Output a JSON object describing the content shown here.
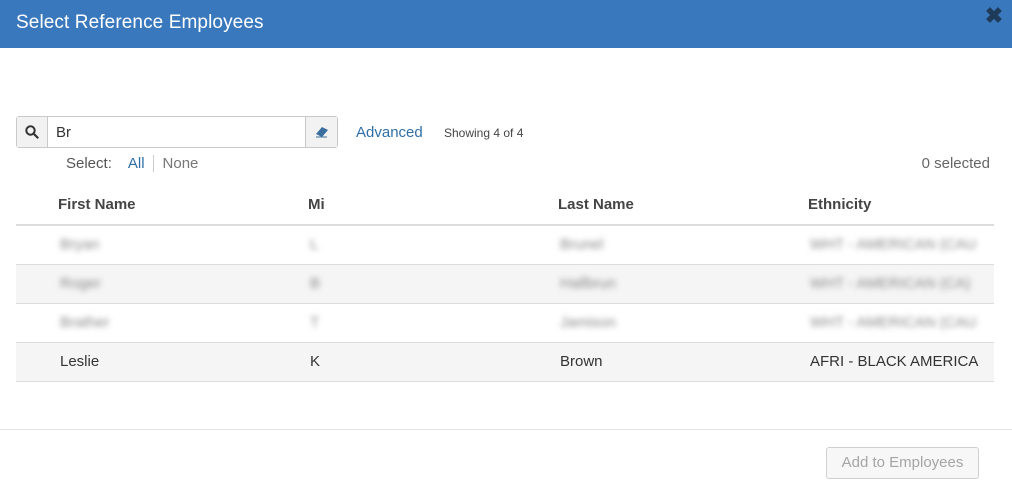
{
  "dialog": {
    "title": "Select Reference Employees",
    "close_icon": "close-icon"
  },
  "search": {
    "value": "Br",
    "advanced_label": "Advanced",
    "showing_text": "Showing 4 of 4"
  },
  "selection": {
    "select_label": "Select:",
    "all_label": "All",
    "none_label": "None",
    "selected_count": "0 selected"
  },
  "table": {
    "headers": [
      "First Name",
      "Mi",
      "Last Name",
      "Ethnicity"
    ],
    "rows": [
      {
        "first": "Bryan",
        "mi": "L",
        "last": "Brunel",
        "ethnicity": "WHT - AMERICAN (CAU",
        "blurred": true
      },
      {
        "first": "Roger",
        "mi": "B",
        "last": "Hallbrun",
        "ethnicity": "WHT - AMERICAN (CA)",
        "blurred": true
      },
      {
        "first": "Brather",
        "mi": "T",
        "last": "Jamison",
        "ethnicity": "WHT - AMERICAN (CAU",
        "blurred": true
      },
      {
        "first": "Leslie",
        "mi": "K",
        "last": "Brown",
        "ethnicity": "AFRI - BLACK AMERICA",
        "blurred": false
      }
    ]
  },
  "footer": {
    "add_label": "Add to Employees"
  },
  "colors": {
    "header_bg": "#3a78bd",
    "link": "#2f6fa8"
  }
}
